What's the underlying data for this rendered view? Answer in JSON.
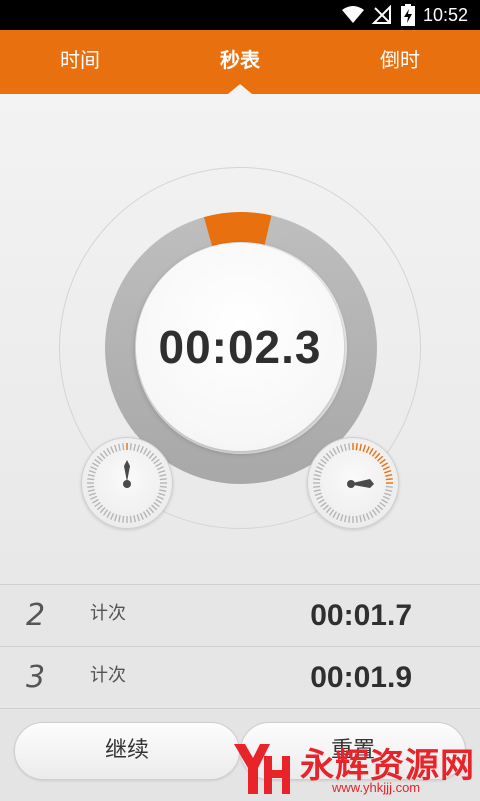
{
  "status_bar": {
    "time": "10:52",
    "icons": [
      "wifi-icon",
      "no-sim-icon",
      "battery-charging-icon"
    ]
  },
  "tabs": [
    {
      "label": "时间",
      "active": false
    },
    {
      "label": "秒表",
      "active": true
    },
    {
      "label": "倒时",
      "active": false
    }
  ],
  "stopwatch": {
    "time": "00:02.3",
    "progress": 0.08,
    "accent_color": "#e9700f"
  },
  "laps": [
    {
      "number": "2",
      "label": "计次",
      "time": "00:01.7"
    },
    {
      "number": "3",
      "label": "计次",
      "time": "00:01.9"
    }
  ],
  "buttons": {
    "left_label": "继续",
    "right_label": "重置"
  },
  "watermark": {
    "text": "永辉资源网",
    "url": "www.yhkjjj.com"
  }
}
